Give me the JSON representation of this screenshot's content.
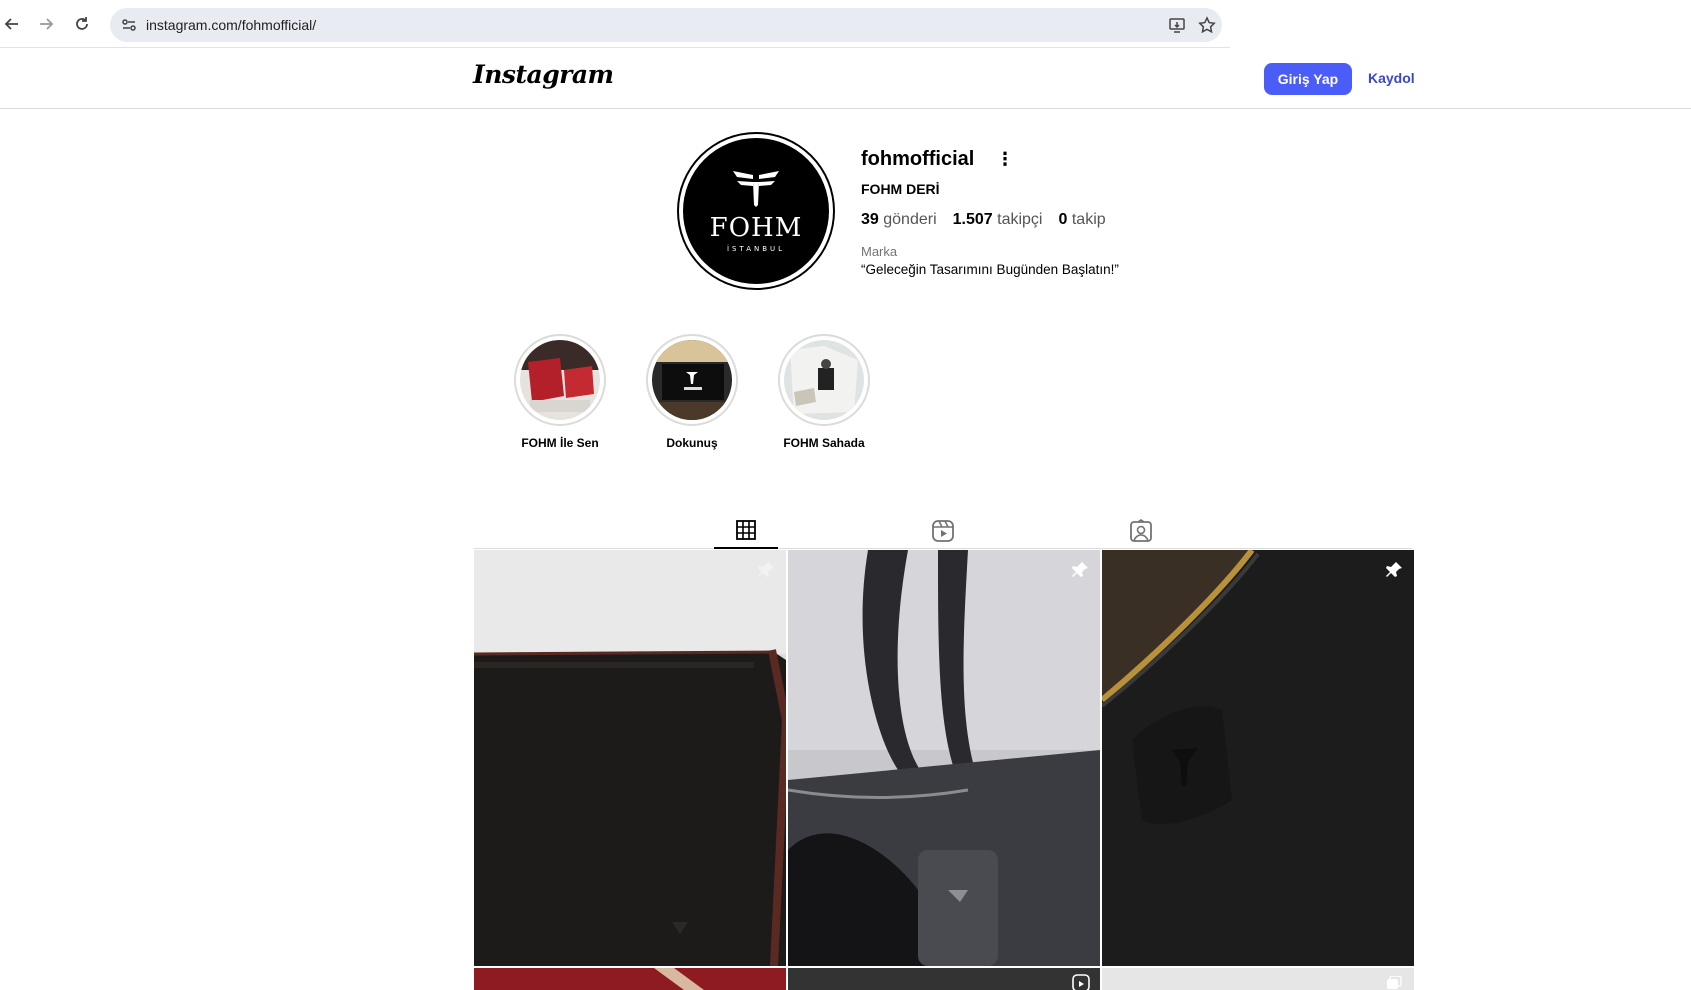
{
  "browser": {
    "url": "instagram.com/fohmofficial/",
    "back_icon": "arrow-left-icon",
    "forward_icon": "arrow-right-icon",
    "reload_icon": "reload-icon"
  },
  "header": {
    "logo": "Instagram",
    "login_label": "Giriş Yap",
    "signup_label": "Kaydol",
    "accent_color": "#4a5df9"
  },
  "profile": {
    "avatar_word": "FOHM",
    "avatar_sub": "İSTANBUL",
    "username": "fohmofficial",
    "full_name": "FOHM DERİ",
    "stats": [
      {
        "num": "39",
        "label": "gönderi"
      },
      {
        "num": "1.507",
        "label": "takipçi"
      },
      {
        "num": "0",
        "label": "takip"
      }
    ],
    "category": "Marka",
    "bio": "“Geleceğin Tasarımını Bugünden Başlatın!”"
  },
  "highlights": [
    {
      "label": "FOHM İle Sen"
    },
    {
      "label": "Dokunuş"
    },
    {
      "label": "FOHM Sahada"
    }
  ],
  "tabs": [
    {
      "icon": "grid-icon",
      "active": true
    },
    {
      "icon": "reels-icon",
      "active": false
    },
    {
      "icon": "tagged-icon",
      "active": false
    }
  ]
}
